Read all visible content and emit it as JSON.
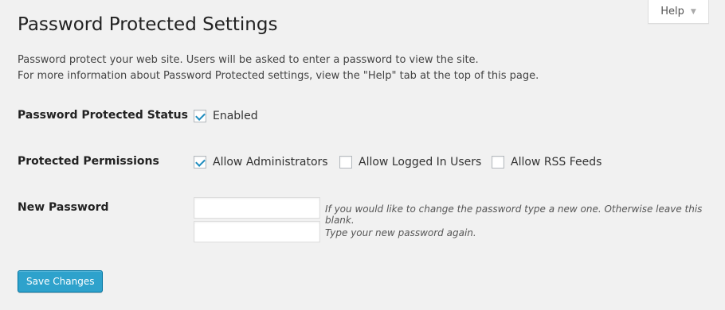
{
  "help_tab": {
    "label": "Help"
  },
  "page_title": "Password Protected Settings",
  "intro": {
    "line1": "Password protect your web site. Users will be asked to enter a password to view the site.",
    "line2": "For more information about Password Protected settings, view the \"Help\" tab at the top of this page."
  },
  "status": {
    "label": "Password Protected Status",
    "enabled": {
      "label": "Enabled",
      "checked": true
    }
  },
  "permissions": {
    "label": "Protected Permissions",
    "options": [
      {
        "label": "Allow Administrators",
        "checked": true
      },
      {
        "label": "Allow Logged In Users",
        "checked": false
      },
      {
        "label": "Allow RSS Feeds",
        "checked": false
      }
    ]
  },
  "new_password": {
    "label": "New Password",
    "field1": {
      "value": "",
      "description": "If you would like to change the password type a new one. Otherwise leave this blank."
    },
    "field2": {
      "value": "",
      "description": "Type your new password again."
    }
  },
  "save_button": {
    "label": "Save Changes"
  },
  "colors": {
    "accent": "#2ea2cc",
    "checkmark": "#1e8cbe",
    "background": "#f1f1f1"
  },
  "icons": {
    "help_arrow": "chevron-down-icon",
    "checkbox": "checkbox-icon"
  }
}
